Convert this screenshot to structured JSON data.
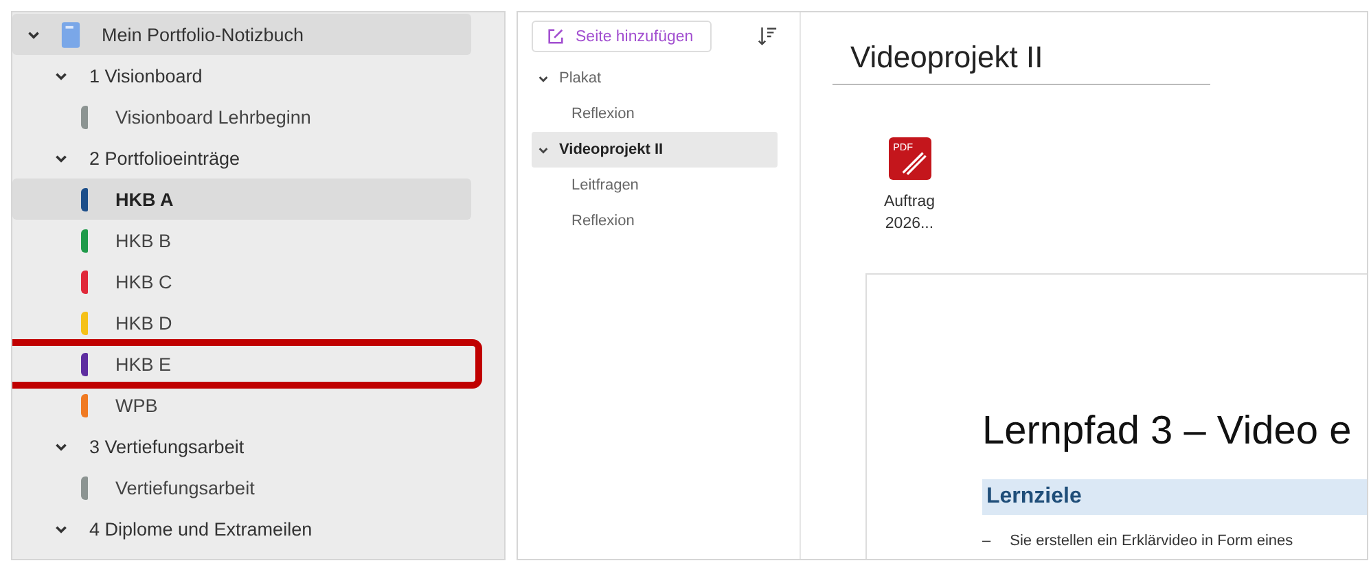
{
  "notebook": {
    "title": "Mein Portfolio-Notizbuch",
    "expanded": true,
    "selected": true,
    "sections": [
      {
        "title": "1 Visionboard",
        "expanded": true,
        "pages": [
          {
            "title": "Visionboard Lehrbeginn",
            "color": "#8c9492",
            "selected": false,
            "highlighted": false
          }
        ]
      },
      {
        "title": "2 Portfolioeinträge",
        "expanded": true,
        "pages": [
          {
            "title": "HKB A",
            "color": "#1d4f8a",
            "selected": true,
            "highlighted": false
          },
          {
            "title": "HKB B",
            "color": "#1f9a4a",
            "selected": false,
            "highlighted": false
          },
          {
            "title": "HKB C",
            "color": "#e0293a",
            "selected": false,
            "highlighted": false
          },
          {
            "title": "HKB D",
            "color": "#f5c118",
            "selected": false,
            "highlighted": false
          },
          {
            "title": "HKB E",
            "color": "#5e2ea0",
            "selected": false,
            "highlighted": true
          },
          {
            "title": "WPB",
            "color": "#f07a22",
            "selected": false,
            "highlighted": false
          }
        ]
      },
      {
        "title": "3 Vertiefungsarbeit",
        "expanded": true,
        "pages": [
          {
            "title": "Vertiefungsarbeit",
            "color": "#8c9492",
            "selected": false,
            "highlighted": false
          }
        ]
      },
      {
        "title": "4 Diplome und Extrameilen",
        "expanded": true
      }
    ]
  },
  "page_list": {
    "add_button": "Seite hinzufügen",
    "groups": [
      {
        "title": "Plakat",
        "expanded": true,
        "selected": false,
        "children": [
          {
            "title": "Reflexion"
          }
        ]
      },
      {
        "title": "Videoprojekt II",
        "expanded": true,
        "selected": true,
        "children": [
          {
            "title": "Leitfragen"
          },
          {
            "title": "Reflexion"
          }
        ]
      }
    ]
  },
  "page": {
    "title": "Videoprojekt II",
    "attachment": {
      "icon_label": "PDF",
      "name": "Auftrag 2026..."
    },
    "document": {
      "heading": "Lernpfad 3 – Video e",
      "subheading": "Lernziele",
      "bullet": "–",
      "text": "Sie erstellen ein Erklärvideo in Form eines"
    }
  }
}
